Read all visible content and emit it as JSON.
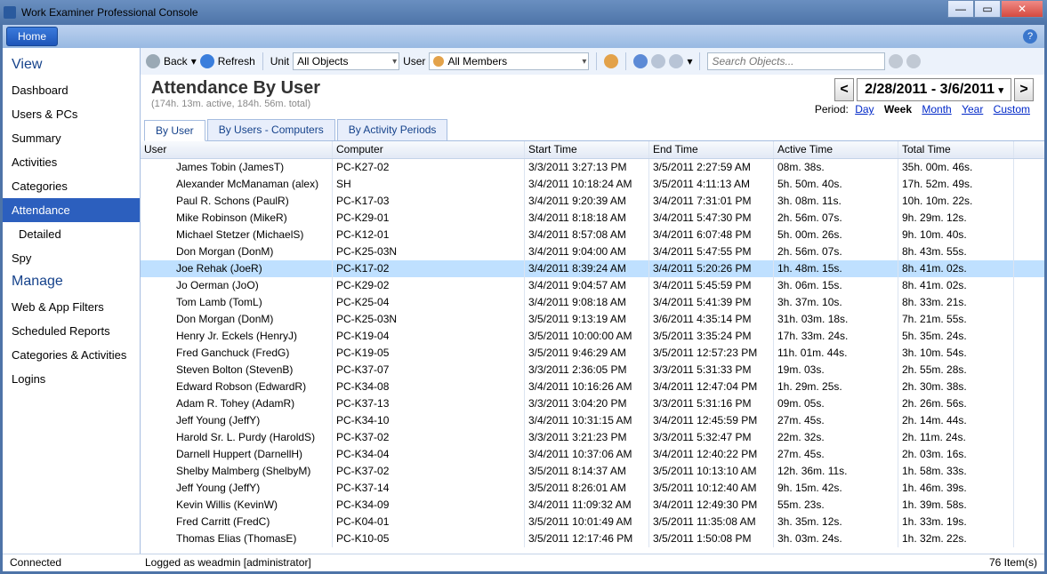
{
  "window": {
    "title": "Work Examiner Professional Console"
  },
  "menubar": {
    "home": "Home"
  },
  "nav": {
    "view_head": "View",
    "view_items": [
      "Dashboard",
      "Users & PCs",
      "Summary",
      "Activities",
      "Categories",
      "Attendance",
      "Detailed",
      "Spy"
    ],
    "view_selected": 5,
    "sub_index": 6,
    "manage_head": "Manage",
    "manage_items": [
      "Web & App Filters",
      "Scheduled Reports",
      "Categories & Activities",
      "Logins"
    ]
  },
  "toolbar": {
    "back": "Back",
    "refresh": "Refresh",
    "unit_label": "Unit",
    "unit_value": "All Objects",
    "user_label": "User",
    "user_value": "All Members",
    "search_placeholder": "Search Objects..."
  },
  "header": {
    "title": "Attendance By User",
    "subtitle": "(174h. 13m. active, 184h. 56m. total)",
    "date_range": "2/28/2011 - 3/6/2011",
    "period_label": "Period:",
    "periods": {
      "day": "Day",
      "week": "Week",
      "month": "Month",
      "year": "Year",
      "custom": "Custom"
    }
  },
  "tabs": {
    "items": [
      "By User",
      "By Users - Computers",
      "By Activity Periods"
    ],
    "active": 0
  },
  "grid": {
    "columns": [
      "User",
      "Computer",
      "Start Time",
      "End Time",
      "Active Time",
      "Total Time"
    ],
    "selected_row": 6,
    "rows": [
      [
        "James Tobin (JamesT)",
        "PC-K27-02",
        "3/3/2011 3:27:13 PM",
        "3/5/2011 2:27:59 AM",
        "08m. 38s.",
        "35h. 00m. 46s."
      ],
      [
        "Alexander McManaman (alex)",
        "SH",
        "3/4/2011 10:18:24 AM",
        "3/5/2011 4:11:13 AM",
        "5h. 50m. 40s.",
        "17h. 52m. 49s."
      ],
      [
        "Paul R. Schons  (PaulR)",
        "PC-K17-03",
        "3/4/2011 9:20:39 AM",
        "3/4/2011 7:31:01 PM",
        "3h. 08m. 11s.",
        "10h. 10m. 22s."
      ],
      [
        "Mike Robinson (MikeR)",
        "PC-K29-01",
        "3/4/2011 8:18:18 AM",
        "3/4/2011 5:47:30 PM",
        "2h. 56m. 07s.",
        "9h. 29m. 12s."
      ],
      [
        "Michael Stetzer  (MichaelS)",
        "PC-K12-01",
        "3/4/2011 8:57:08 AM",
        "3/4/2011 6:07:48 PM",
        "5h. 00m. 26s.",
        "9h. 10m. 40s."
      ],
      [
        "Don Morgan (DonM)",
        "PC-K25-03N",
        "3/4/2011 9:04:00 AM",
        "3/4/2011 5:47:55 PM",
        "2h. 56m. 07s.",
        "8h. 43m. 55s."
      ],
      [
        "Joe Rehak  (JoeR)",
        "PC-K17-02",
        "3/4/2011 8:39:24 AM",
        "3/4/2011 5:20:26 PM",
        "1h. 48m. 15s.",
        "8h. 41m. 02s."
      ],
      [
        "Jo Oerman (JoO)",
        "PC-K29-02",
        "3/4/2011 9:04:57 AM",
        "3/4/2011 5:45:59 PM",
        "3h. 06m. 15s.",
        "8h. 41m. 02s."
      ],
      [
        "Tom Lamb (TomL)",
        "PC-K25-04",
        "3/4/2011 9:08:18 AM",
        "3/4/2011 5:41:39 PM",
        "3h. 37m. 10s.",
        "8h. 33m. 21s."
      ],
      [
        "Don Morgan (DonM)",
        "PC-K25-03N",
        "3/5/2011 9:13:19 AM",
        "3/6/2011 4:35:14 PM",
        "31h. 03m. 18s.",
        "7h. 21m. 55s."
      ],
      [
        "Henry Jr. Eckels (HenryJ)",
        "PC-K19-04",
        "3/5/2011 10:00:00 AM",
        "3/5/2011 3:35:24 PM",
        "17h. 33m. 24s.",
        "5h. 35m. 24s."
      ],
      [
        "Fred Ganchuck  (FredG)",
        "PC-K19-05",
        "3/5/2011 9:46:29 AM",
        "3/5/2011 12:57:23 PM",
        "11h. 01m. 44s.",
        "3h. 10m. 54s."
      ],
      [
        "Steven Bolton (StevenB)",
        "PC-K37-07",
        "3/3/2011 2:36:05 PM",
        "3/3/2011 5:31:33 PM",
        "19m. 03s.",
        "2h. 55m. 28s."
      ],
      [
        "Edward Robson  (EdwardR)",
        "PC-K34-08",
        "3/4/2011 10:16:26 AM",
        "3/4/2011 12:47:04 PM",
        "1h. 29m. 25s.",
        "2h. 30m. 38s."
      ],
      [
        "Adam R. Tohey  (AdamR)",
        "PC-K37-13",
        "3/3/2011 3:04:20 PM",
        "3/3/2011 5:31:16 PM",
        "09m. 05s.",
        "2h. 26m. 56s."
      ],
      [
        "Jeff Young (JeffY)",
        "PC-K34-10",
        "3/4/2011 10:31:15 AM",
        "3/4/2011 12:45:59 PM",
        "27m. 45s.",
        "2h. 14m. 44s."
      ],
      [
        "Harold Sr. L. Purdy  (HaroldS)",
        "PC-K37-02",
        "3/3/2011 3:21:23 PM",
        "3/3/2011 5:32:47 PM",
        "22m. 32s.",
        "2h. 11m. 24s."
      ],
      [
        "Darnell Huppert (DarnellH)",
        "PC-K34-04",
        "3/4/2011 10:37:06 AM",
        "3/4/2011 12:40:22 PM",
        "27m. 45s.",
        "2h. 03m. 16s."
      ],
      [
        "Shelby Malmberg (ShelbyM)",
        "PC-K37-02",
        "3/5/2011 8:14:37 AM",
        "3/5/2011 10:13:10 AM",
        "12h. 36m. 11s.",
        "1h. 58m. 33s."
      ],
      [
        "Jeff Young (JeffY)",
        "PC-K37-14",
        "3/5/2011 8:26:01 AM",
        "3/5/2011 10:12:40 AM",
        "9h. 15m. 42s.",
        "1h. 46m. 39s."
      ],
      [
        "Kevin Willis (KevinW)",
        "PC-K34-09",
        "3/4/2011 11:09:32 AM",
        "3/4/2011 12:49:30 PM",
        "55m. 23s.",
        "1h. 39m. 58s."
      ],
      [
        "Fred Carritt (FredC)",
        "PC-K04-01",
        "3/5/2011 10:01:49 AM",
        "3/5/2011 11:35:08 AM",
        "3h. 35m. 12s.",
        "1h. 33m. 19s."
      ],
      [
        "Thomas Elias  (ThomasE)",
        "PC-K10-05",
        "3/5/2011 12:17:46 PM",
        "3/5/2011 1:50:08 PM",
        "3h. 03m. 24s.",
        "1h. 32m. 22s."
      ]
    ]
  },
  "status": {
    "left": "Connected",
    "mid": "Logged as weadmin [administrator]",
    "right": "76 Item(s)"
  }
}
